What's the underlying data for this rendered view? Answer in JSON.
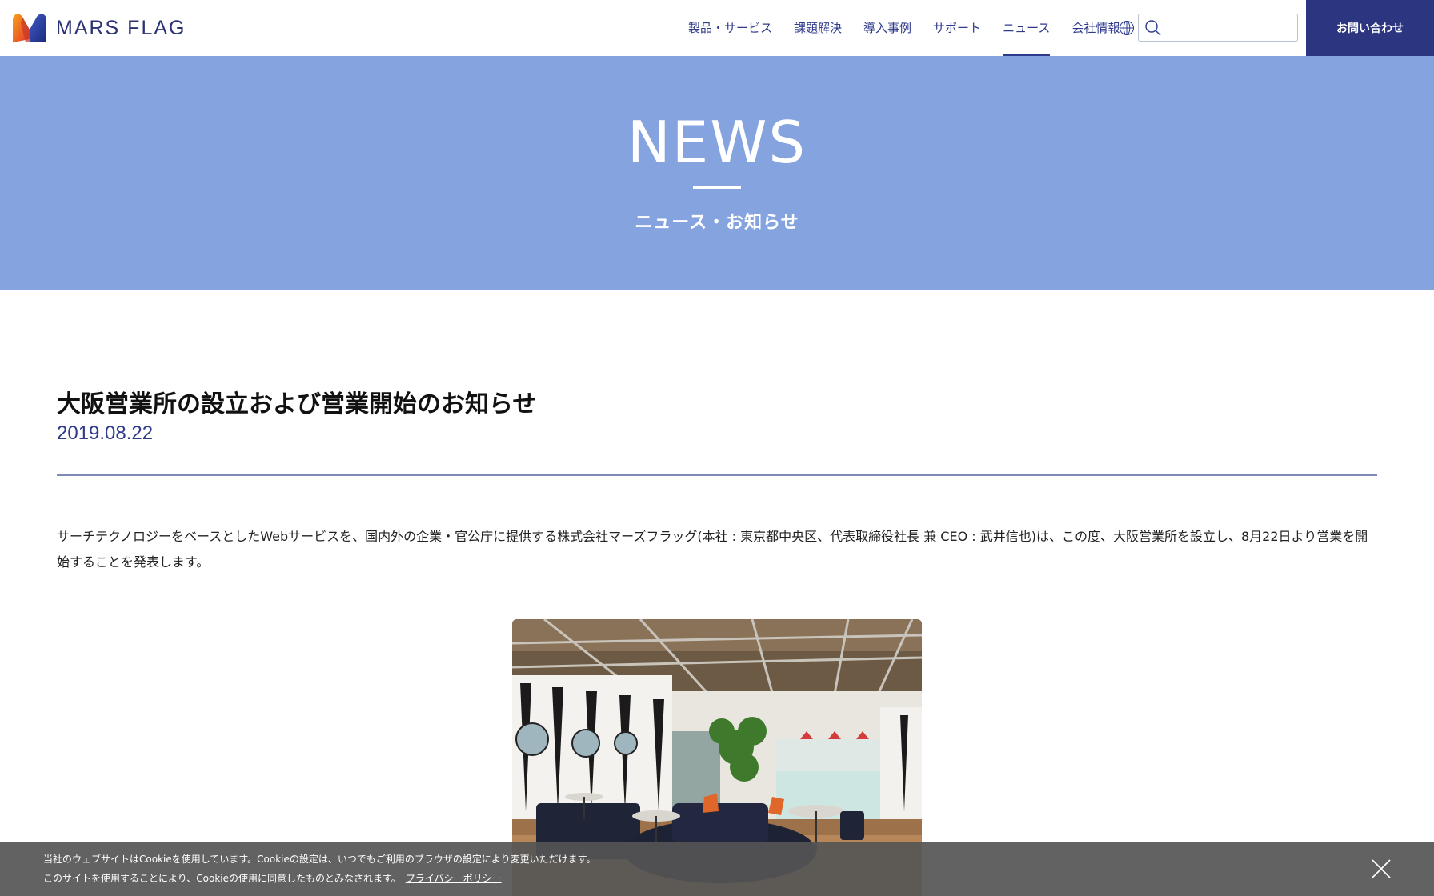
{
  "header": {
    "logo_text": "MARS FLAG",
    "nav": [
      {
        "label": "製品・サービス",
        "active": false
      },
      {
        "label": "課題解決",
        "active": false
      },
      {
        "label": "導入事例",
        "active": false
      },
      {
        "label": "サポート",
        "active": false
      },
      {
        "label": "ニュース",
        "active": true
      },
      {
        "label": "会社情報",
        "active": false
      }
    ],
    "language_icon": "globe-icon",
    "search": {
      "value": "",
      "placeholder": "",
      "icon": "search-icon"
    },
    "contact_label": "お問い合わせ"
  },
  "hero": {
    "title": "NEWS",
    "subtitle": "ニュース・お知らせ"
  },
  "article": {
    "title": "大阪営業所の設立および営業開始のお知らせ",
    "date": "2019.08.22",
    "body": "サーチテクノロジーをベースとしたWebサービスを、国内外の企業・官公庁に提供する株式会社マーズフラッグ(本社 : 東京都中央区、代表取締役社長 兼 CEO : 武井信也)は、この度、大阪営業所を設立し、8月22日より営業を開始することを発表します。",
    "photo": "office-lounge-photo"
  },
  "cookie": {
    "line1": "当社のウェブサイトはCookieを使用しています。Cookieの設定は、いつでもご利用のブラウザの設定により変更いただけます。",
    "line2": "このサイトを使用することにより、Cookieの使用に同意したものとみなされます。",
    "link": "プライバシーポリシー",
    "close_icon": "close-icon"
  },
  "colors": {
    "brand_navy": "#2b3580",
    "hero_blue": "#84a3df",
    "nav_text": "#2e3a8c"
  }
}
